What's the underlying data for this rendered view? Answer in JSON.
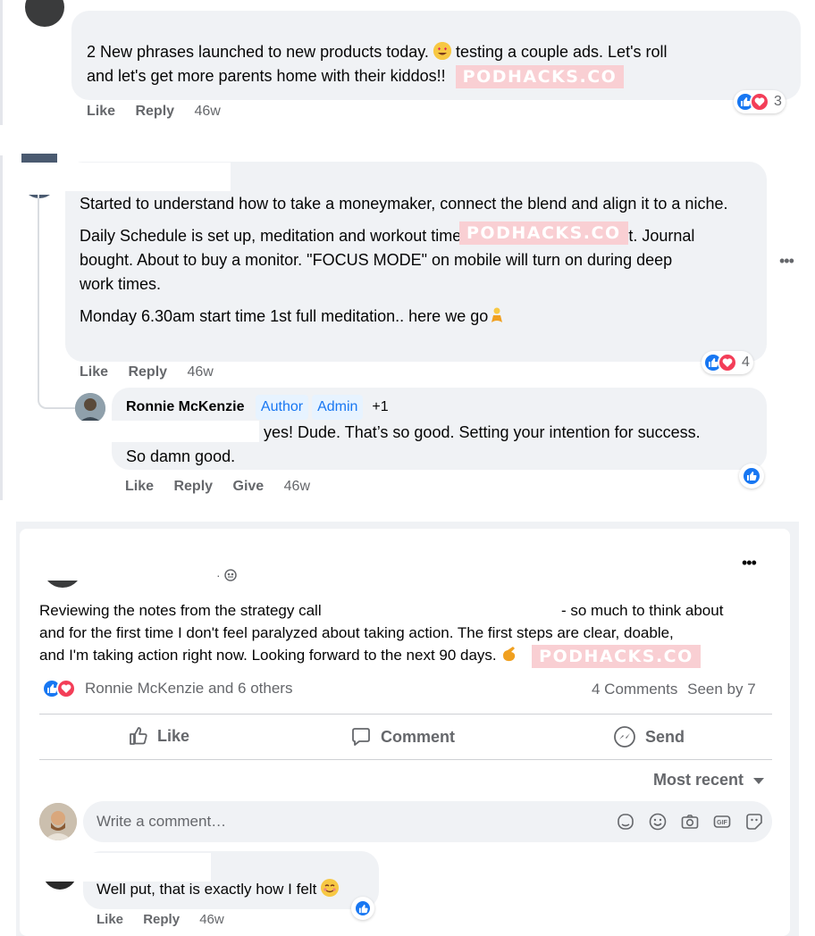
{
  "watermark": "PODHACKS.CO",
  "colors": {
    "like_blue": "#1877f2",
    "love_red": "#f33e58",
    "bubble_bg": "#f0f2f5",
    "meta_grey": "#65676b",
    "badge_bg": "#e7f3ff"
  },
  "comment1": {
    "text_line1": "2 New phrases launched to new products today.",
    "text_line1b": "testing a couple ads. Let's roll",
    "text_line2": "and let's get more parents home with their kiddos!!",
    "actions": {
      "like": "Like",
      "reply": "Reply",
      "time": "46w"
    },
    "reactions": {
      "icons": [
        "like-icon",
        "love-icon"
      ],
      "count": "3"
    }
  },
  "comment2": {
    "para1": "Started to understand how to take a moneymaker, connect the blend and align it to a niche.",
    "para2": "Daily Schedule is set up, meditation and workout times all set, weights bought. Journal bought. About to buy a monitor. \"FOCUS MODE\" on mobile will turn on during deep work times.",
    "para3": "Monday 6.30am start time 1st full meditation.. here we go",
    "actions": {
      "like": "Like",
      "reply": "Reply",
      "time": "46w"
    },
    "reactions": {
      "icons": [
        "like-icon",
        "love-icon"
      ],
      "count": "4"
    },
    "reply": {
      "author": "Ronnie McKenzie",
      "badges": [
        "Author",
        "Admin",
        "+1"
      ],
      "text_line1": "yes! Dude. That’s so good. Setting your intention for success.",
      "text_line2": "So damn good.",
      "actions": {
        "like": "Like",
        "reply": "Reply",
        "give": "Give",
        "time": "46w"
      }
    }
  },
  "post": {
    "body_line1a": "Reviewing the notes from the strategy call",
    "body_line1b": "- so much to think about",
    "body_line2": "and for the first time I don't feel paralyzed about taking action. The first steps are clear, doable,",
    "body_line3": "and I'm taking action right now. Looking forward to the next 90 days.",
    "reactions_text": "Ronnie McKenzie and 6 others",
    "comments_count": "4 Comments",
    "seen_by": "Seen by 7",
    "buttons": {
      "like": "Like",
      "comment": "Comment",
      "send": "Send"
    },
    "sort_label": "Most recent",
    "comment_placeholder": "Write a comment…",
    "latest_comment": {
      "text": "Well put, that is exactly how I felt",
      "actions": {
        "like": "Like",
        "reply": "Reply",
        "time": "46w"
      }
    }
  }
}
